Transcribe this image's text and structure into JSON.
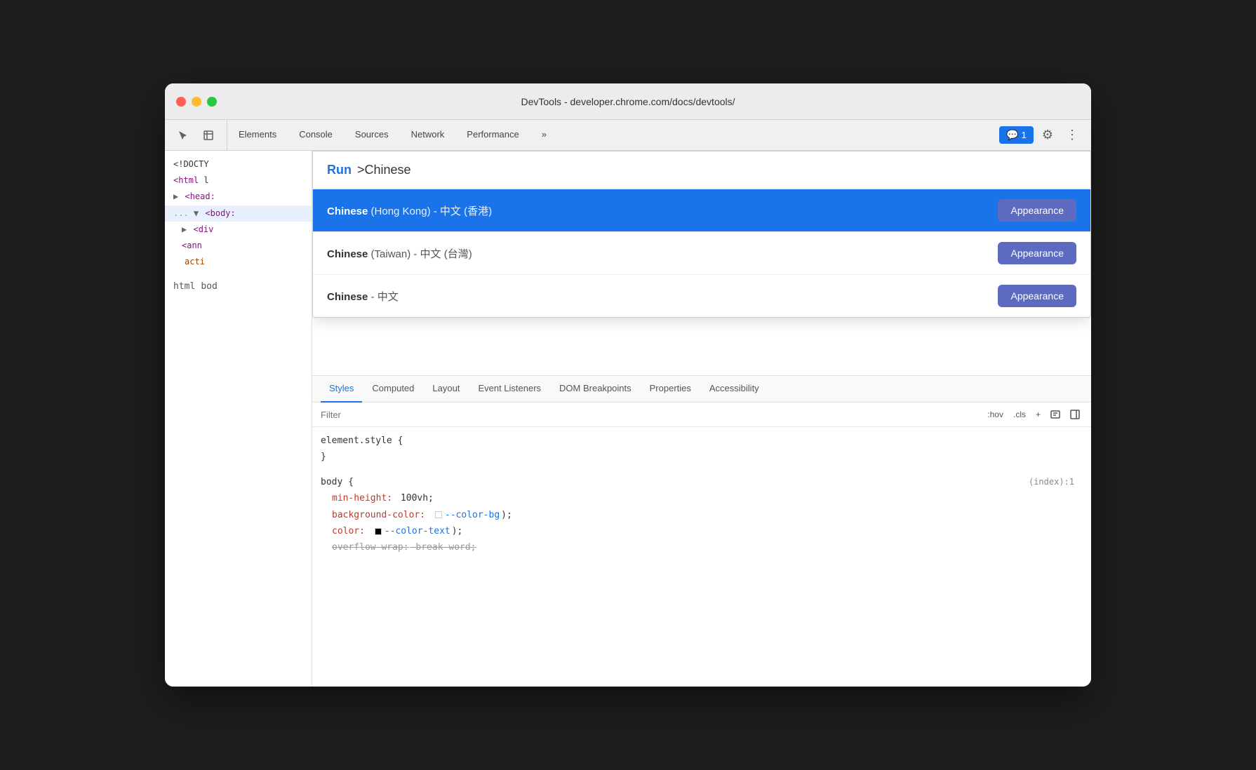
{
  "window": {
    "title": "DevTools - developer.chrome.com/docs/devtools/"
  },
  "titlebar": {
    "close_label": "",
    "min_label": "",
    "max_label": ""
  },
  "toolbar": {
    "tabs": [
      {
        "label": "Elements",
        "id": "elements"
      },
      {
        "label": "Console",
        "id": "console"
      },
      {
        "label": "Sources",
        "id": "sources"
      },
      {
        "label": "Network",
        "id": "network"
      },
      {
        "label": "Performance",
        "id": "performance"
      },
      {
        "label": "»",
        "id": "more"
      }
    ],
    "badge_label": "1",
    "settings_label": "⚙",
    "more_label": "⋮"
  },
  "dom": {
    "lines": [
      {
        "text": "<!DOCTY",
        "type": "text"
      },
      {
        "text": "<html l",
        "type": "tag"
      },
      {
        "text": "▶ <head:",
        "type": "tag"
      },
      {
        "text": "... ▼ <body:",
        "type": "tag",
        "selected": true
      },
      {
        "text": "  ▶ <div",
        "type": "tag"
      },
      {
        "text": "  <ann",
        "type": "tag"
      },
      {
        "text": "  acti",
        "type": "attr"
      }
    ]
  },
  "breadcrumb": {
    "items": [
      "html",
      "bod"
    ]
  },
  "command": {
    "run_label": "Run",
    "query": ">Chinese"
  },
  "results": [
    {
      "id": "hk",
      "bold_text": "Chinese",
      "rest_text": " (Hong Kong) - 中文 (香港)",
      "button_label": "Appearance",
      "selected": true
    },
    {
      "id": "tw",
      "bold_text": "Chinese",
      "rest_text": " (Taiwan) - 中文 (台灣)",
      "button_label": "Appearance",
      "selected": false
    },
    {
      "id": "cn",
      "bold_text": "Chinese",
      "rest_text": " - 中文",
      "button_label": "Appearance",
      "selected": false
    }
  ],
  "styles_tabs": [
    {
      "label": "Styles",
      "id": "styles",
      "active": true
    },
    {
      "label": "Computed",
      "id": "computed"
    },
    {
      "label": "Layout",
      "id": "layout"
    },
    {
      "label": "Event Listeners",
      "id": "event-listeners"
    },
    {
      "label": "DOM Breakpoints",
      "id": "dom-breakpoints"
    },
    {
      "label": "Properties",
      "id": "properties"
    },
    {
      "label": "Accessibility",
      "id": "accessibility"
    }
  ],
  "filter": {
    "placeholder": "Filter",
    "hov_label": ":hov",
    "cls_label": ".cls",
    "plus_label": "+"
  },
  "css": {
    "element_style": {
      "selector": "element.style {",
      "close": "}"
    },
    "body_rule": {
      "selector": "body {",
      "file_ref": "(index):1",
      "properties": [
        {
          "prop": "min-height:",
          "val": "100vh;"
        },
        {
          "prop": "background-color:",
          "val": "var(--color-bg);",
          "has_swatch": true,
          "swatch_type": "white",
          "val_link": "--color-bg"
        },
        {
          "prop": "color:",
          "val": "var(--color-text);",
          "has_swatch": true,
          "swatch_type": "black",
          "val_link": "--color-text"
        },
        {
          "prop": "overflow-wrap:",
          "val": "break-word;",
          "strikethrough": true
        }
      ],
      "close": "}"
    }
  }
}
